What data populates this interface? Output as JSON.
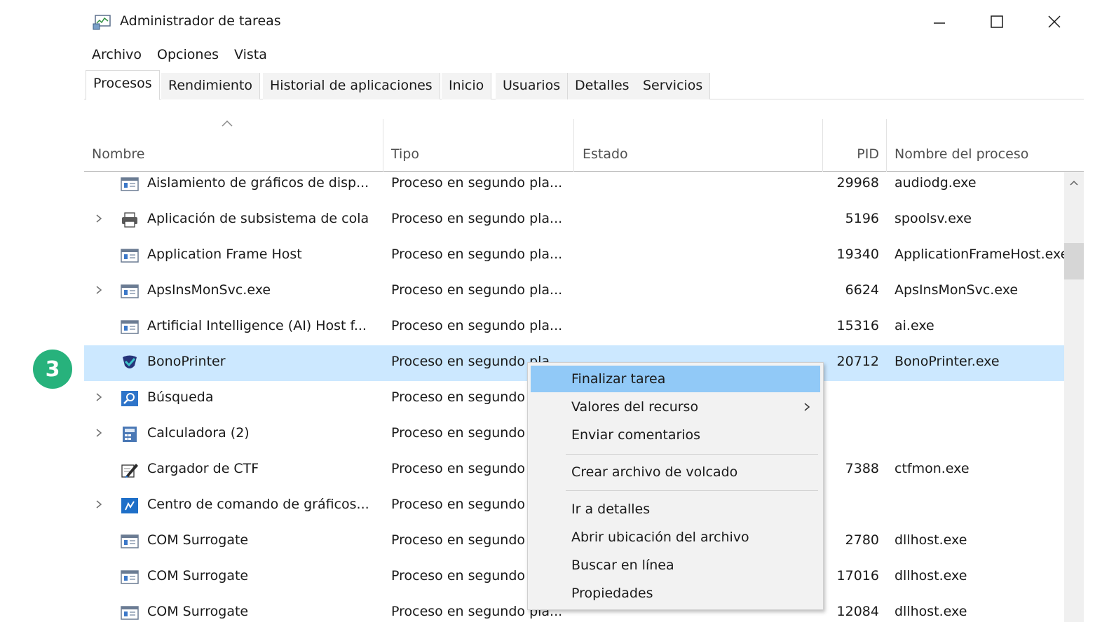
{
  "window": {
    "title": "Administrador de tareas"
  },
  "menubar": [
    "Archivo",
    "Opciones",
    "Vista"
  ],
  "tabs": [
    "Procesos",
    "Rendimiento",
    "Historial de aplicaciones",
    "Inicio",
    "Usuarios",
    "Detalles",
    "Servicios"
  ],
  "active_tab": "Procesos",
  "columns": {
    "name": "Nombre",
    "type": "Tipo",
    "status": "Estado",
    "pid": "PID",
    "process_name": "Nombre del proceso"
  },
  "rows": [
    {
      "name": "Aislamiento de gráficos de disp...",
      "type": "Proceso en segundo pla...",
      "pid": "29968",
      "process": "audiodg.exe",
      "expandable": false,
      "icon": "app-window-icon"
    },
    {
      "name": "Aplicación de subsistema de cola",
      "type": "Proceso en segundo pla...",
      "pid": "5196",
      "process": "spoolsv.exe",
      "expandable": true,
      "icon": "printer-icon"
    },
    {
      "name": "Application Frame Host",
      "type": "Proceso en segundo pla...",
      "pid": "19340",
      "process": "ApplicationFrameHost.exe",
      "expandable": false,
      "icon": "app-window-icon"
    },
    {
      "name": "ApsInsMonSvc.exe",
      "type": "Proceso en segundo pla...",
      "pid": "6624",
      "process": "ApsInsMonSvc.exe",
      "expandable": true,
      "icon": "app-window-icon"
    },
    {
      "name": "Artificial Intelligence (AI) Host f...",
      "type": "Proceso en segundo pla...",
      "pid": "15316",
      "process": "ai.exe",
      "expandable": false,
      "icon": "app-window-icon"
    },
    {
      "name": "BonoPrinter",
      "type": "Proceso en segundo pla...",
      "pid": "20712",
      "process": "BonoPrinter.exe",
      "expandable": false,
      "icon": "bonoprinter-icon",
      "selected": true
    },
    {
      "name": "Búsqueda",
      "type": "Proceso en segundo",
      "pid": "",
      "process": "",
      "expandable": true,
      "icon": "search-icon"
    },
    {
      "name": "Calculadora (2)",
      "type": "Proceso en segundo",
      "pid": "",
      "process": "",
      "expandable": true,
      "icon": "calculator-icon"
    },
    {
      "name": "Cargador de CTF",
      "type": "Proceso en segundo",
      "pid": "7388",
      "process": "ctfmon.exe",
      "expandable": false,
      "icon": "pen-icon"
    },
    {
      "name": "Centro de comando de gráficos...",
      "type": "Proceso en segundo",
      "pid": "",
      "process": "",
      "expandable": true,
      "icon": "graphics-command-icon"
    },
    {
      "name": "COM Surrogate",
      "type": "Proceso en segundo",
      "pid": "2780",
      "process": "dllhost.exe",
      "expandable": false,
      "icon": "app-window-icon"
    },
    {
      "name": "COM Surrogate",
      "type": "Proceso en segundo",
      "pid": "17016",
      "process": "dllhost.exe",
      "expandable": false,
      "icon": "app-window-icon"
    },
    {
      "name": "COM Surrogate",
      "type": "Proceso en segundo pla...",
      "pid": "12084",
      "process": "dllhost.exe",
      "expandable": false,
      "icon": "app-window-icon"
    }
  ],
  "context_menu": {
    "items": [
      "Finalizar tarea",
      "Valores del recurso",
      "Enviar comentarios",
      "Crear archivo de volcado",
      "Ir a detalles",
      "Abrir ubicación del archivo",
      "Buscar en línea",
      "Propiedades"
    ],
    "highlighted": "Finalizar tarea",
    "submenu_item": "Valores del recurso"
  },
  "badge": {
    "label": "3",
    "color": "#27b27c"
  },
  "colors": {
    "selection": "#cce8ff",
    "menu_highlight": "#91c9f7"
  }
}
